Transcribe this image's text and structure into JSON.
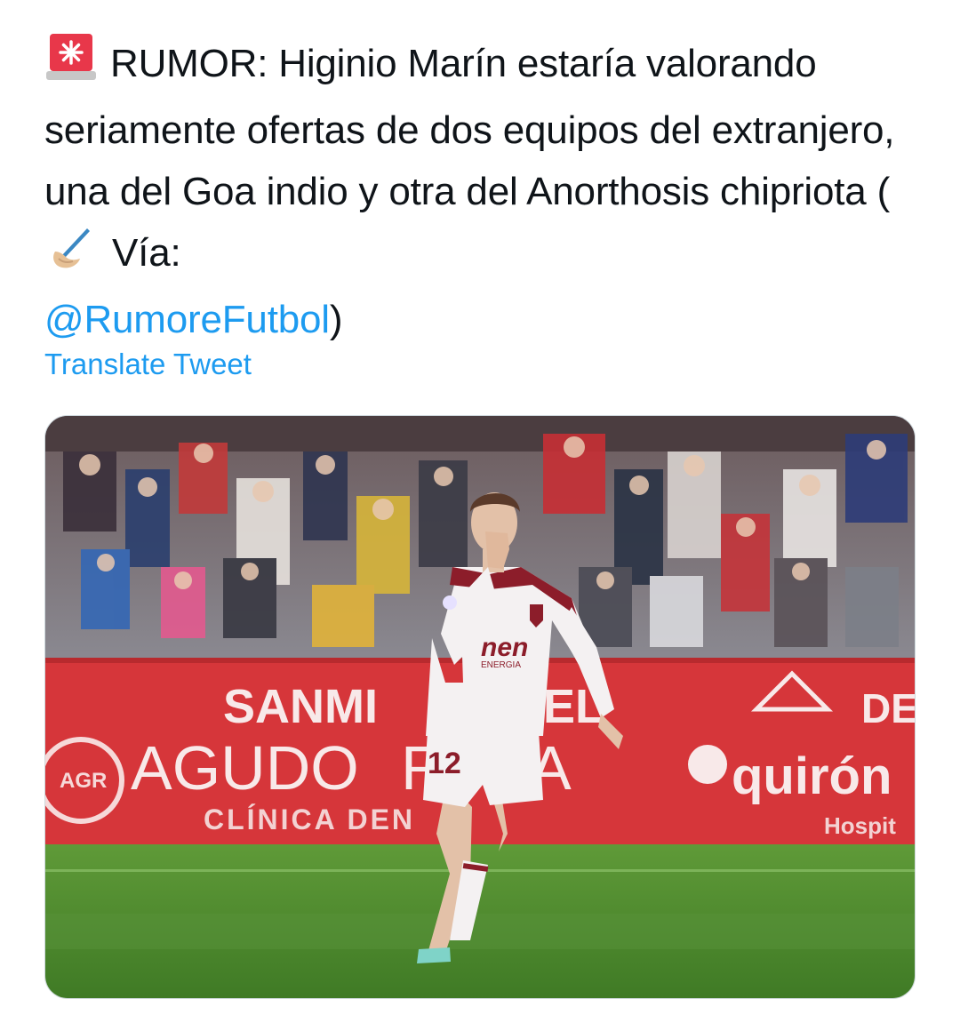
{
  "tweet": {
    "text_rumor": "RUMOR: Higinio Marín estaría valorando seriamente ofertas de dos equipos del extranjero, una del Goa indio y otra del Anorthosis chipriota (",
    "text_via": " Vía:",
    "mention": "@RumoreFutbol",
    "text_close": ")",
    "translate_label": "Translate Tweet",
    "emoji_siren": "rotating-light-emoji",
    "emoji_pen": "writing-hand-emoji"
  },
  "media": {
    "description_icon": "photo",
    "ad_board": {
      "sponsor1": "SANMI",
      "sponsor1_tail": "EL",
      "sponsor2": "AGUDO",
      "sponsor2_r": "R",
      "sponsor2_tail": "A",
      "sponsor2_sub": "CLÍNICA DEN",
      "sponsor3_top": "DE",
      "sponsor3": "quirón",
      "sponsor3_sub": "Hospit",
      "agr_logo": "AGR"
    },
    "jersey": {
      "sponsor": "nen",
      "sponsor_sub": "ENERGIA",
      "number": "12"
    },
    "colors": {
      "board_red": "#d6363a",
      "pitch_green": "#4f8b2f",
      "kit_white": "#f4f1f2",
      "kit_maroon": "#8c1d2a"
    }
  }
}
